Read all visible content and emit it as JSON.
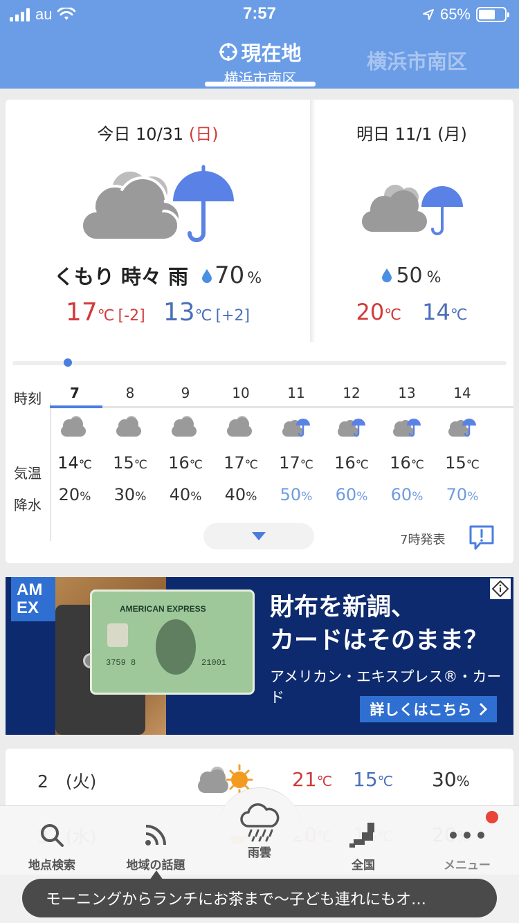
{
  "status_bar": {
    "carrier": "au",
    "time": "7:57",
    "battery": "65%",
    "battery_level": 0.65
  },
  "header": {
    "current_tab_title": "現在地",
    "current_tab_sub": "横浜市南区",
    "other_tab": "横浜市南区"
  },
  "today": {
    "date_label": "今日 10/31",
    "weekday": "(日)",
    "condition": "くもり 時々 雨",
    "precip": "70",
    "high": "17",
    "high_diff": "[-2]",
    "low": "13",
    "low_diff": "[+2]",
    "icon": "cloud-umbrella-icon"
  },
  "tomorrow": {
    "date_label": "明日 11/1 (月)",
    "precip": "50",
    "high": "20",
    "low": "14",
    "icon": "cloud-umbrella-icon"
  },
  "hourly": {
    "label_time": "時刻",
    "label_temp": "気温",
    "label_precip": "降水",
    "hours": [
      {
        "time": "7",
        "temp": "14",
        "precip": "20",
        "icon": "cloud-icon"
      },
      {
        "time": "8",
        "temp": "15",
        "precip": "30",
        "icon": "cloud-icon"
      },
      {
        "time": "9",
        "temp": "16",
        "precip": "40",
        "icon": "cloud-icon"
      },
      {
        "time": "10",
        "temp": "17",
        "precip": "40",
        "icon": "cloud-icon"
      },
      {
        "time": "11",
        "temp": "17",
        "precip": "50",
        "icon": "cloud-umbrella-icon"
      },
      {
        "time": "12",
        "temp": "16",
        "precip": "60",
        "icon": "cloud-umbrella-icon"
      },
      {
        "time": "13",
        "temp": "16",
        "precip": "60",
        "icon": "cloud-umbrella-icon"
      },
      {
        "time": "14",
        "temp": "15",
        "precip": "70",
        "icon": "cloud-umbrella-icon"
      }
    ],
    "issued": "7時発表"
  },
  "units": {
    "celsius": "℃",
    "percent": "%"
  },
  "ad": {
    "brand_badge": "AM EX",
    "card_title": "AMERICAN EXPRESS",
    "card_num_left": "3759 8",
    "card_num_right": "21001",
    "headline_line1": "財布を新調、",
    "headline_line2": "カードはそのまま？",
    "subtext": "アメリカン・エキスプレス®・カード",
    "cta": "詳しくはこちら"
  },
  "weekly": [
    {
      "date": "2　(火)",
      "icon": "cloud-sun-icon",
      "high": "21",
      "low": "15",
      "precip": "30"
    },
    {
      "date": "3　(水)",
      "icon": "sun-icon",
      "high": "20",
      "low": "14",
      "precip": "20"
    }
  ],
  "nav": {
    "search": "地点検索",
    "topics": "地域の話題",
    "rain": "雨雲",
    "nation": "全国",
    "menu": "メニュー"
  },
  "toast": "モーニングからランチにお茶まで〜子ども連れにもオ…",
  "colors": {
    "header": "#6a9de6",
    "accent": "#4a7de0",
    "high": "#d23a3a",
    "low": "#4a6fb8",
    "rain_high": "#6f9be0"
  }
}
